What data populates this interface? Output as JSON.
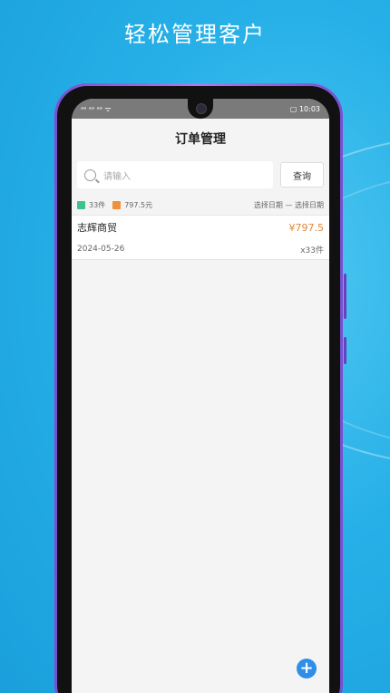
{
  "promo": {
    "headline": "轻松管理客户"
  },
  "status_bar": {
    "left": "ᵃᵃ ᵃᵃ ᵃᵃ ᯤ",
    "right": "▢ 10:03"
  },
  "app": {
    "title": "订单管理",
    "search": {
      "placeholder": "请输入",
      "button_label": "查询"
    },
    "stats": {
      "count": "33件",
      "amount": "797.5元",
      "date_start": "选择日期",
      "separator": "—",
      "date_end": "选择日期"
    },
    "orders": [
      {
        "customer": "志辉商贸",
        "price": "¥797.5",
        "date": "2024-05-26",
        "qty": "x33件"
      }
    ],
    "fab_label": "+"
  },
  "colors": {
    "accent": "#2e8ee8",
    "price": "#e0883a",
    "background": "#27b0e8",
    "phone_frame": "#7a4fd0"
  },
  "icons": [
    "search-icon",
    "add-icon",
    "back-icon",
    "home-icon",
    "recents-icon",
    "count-icon",
    "amount-icon"
  ]
}
